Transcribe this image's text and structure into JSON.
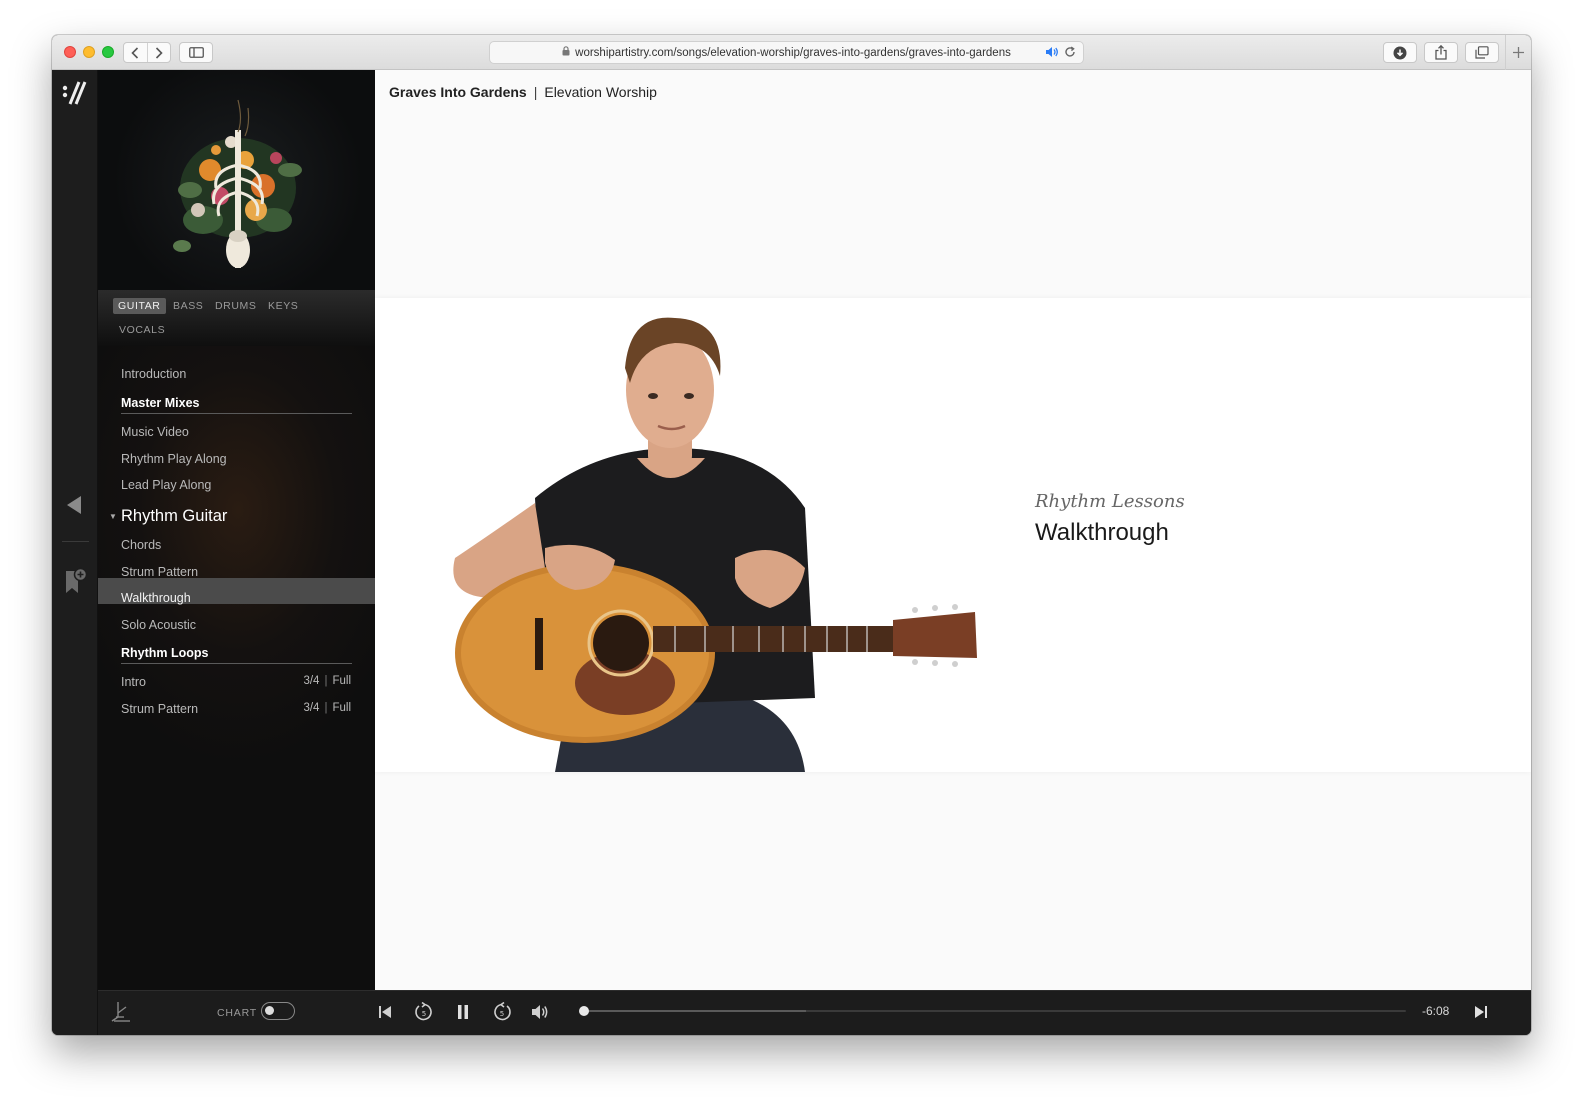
{
  "browser": {
    "url": "worshipartistry.com/songs/elevation-worship/graves-into-gardens/graves-into-gardens"
  },
  "instrument_tabs": [
    "GUITAR",
    "BASS",
    "DRUMS",
    "KEYS",
    "VOCALS"
  ],
  "active_instrument": "GUITAR",
  "menu": {
    "intro": "Introduction",
    "master_mixes_header": "Master Mixes",
    "master_mixes": [
      "Music Video",
      "Rhythm Play Along",
      "Lead Play Along"
    ],
    "section_title": "Rhythm Guitar",
    "section_items": [
      "Chords",
      "Strum Pattern",
      "Walkthrough",
      "Solo Acoustic"
    ],
    "selected_item": "Walkthrough",
    "loops_header": "Rhythm Loops",
    "loops": [
      {
        "name": "Intro",
        "time_sig": "3/4",
        "full": "Full"
      },
      {
        "name": "Strum Pattern",
        "time_sig": "3/4",
        "full": "Full"
      }
    ]
  },
  "header": {
    "song": "Graves Into Gardens",
    "separator": "|",
    "artist": "Elevation Worship"
  },
  "lesson": {
    "kicker": "Rhythm Lessons",
    "title": "Walkthrough"
  },
  "player": {
    "chart_label": "CHART",
    "chart_toggle_on": false,
    "time_remaining": "-6:08",
    "progress": 0.0,
    "buffered": 0.27
  },
  "colors": {
    "audio_icon": "#2a7cf6",
    "selected_row": "#4b4b4b",
    "active_tab": "#5a5a5a"
  }
}
